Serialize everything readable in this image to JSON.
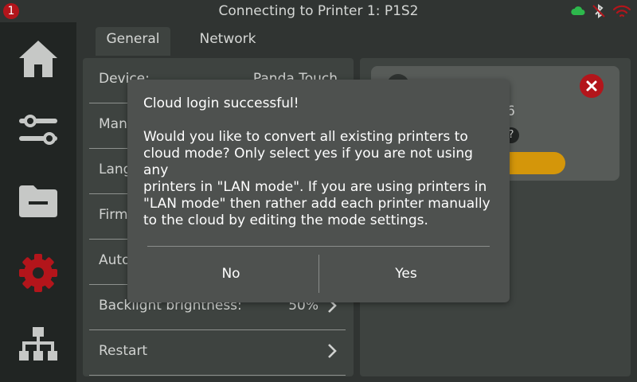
{
  "topbar": {
    "badge_count": "1",
    "title": "Connecting to Printer 1: P1S2",
    "icons": [
      "cloud-icon",
      "bluetooth-disabled-icon",
      "wifi-icon"
    ],
    "cloud_color": "#2db84c",
    "wifi_color": "#b3151b"
  },
  "sidebar": {
    "items": [
      {
        "icon": "home-icon",
        "active": false
      },
      {
        "icon": "sliders-icon",
        "active": false
      },
      {
        "icon": "folder-icon",
        "active": false
      },
      {
        "icon": "gear-icon",
        "active": true
      },
      {
        "icon": "network-icon",
        "active": false
      }
    ],
    "active_color": "#b3151b"
  },
  "tabs": [
    {
      "label": "General",
      "active": true
    },
    {
      "label": "Network",
      "active": false
    }
  ],
  "settings": {
    "rows": [
      {
        "label": "Device:",
        "value": "Panda Touch"
      },
      {
        "label": "Man",
        "value": ""
      },
      {
        "label": "Lang",
        "value": ""
      },
      {
        "label": "Firm",
        "value": ""
      },
      {
        "label": "Auto",
        "value": ""
      },
      {
        "label": "Backlight brightness:",
        "value": "50%"
      },
      {
        "label": "Restart",
        "value": ""
      }
    ]
  },
  "printer_card": {
    "visible_fragment": "6",
    "help_glyph": "?",
    "progress_color": "#d4960a",
    "close_color": "#b3151b"
  },
  "dialog": {
    "title": "Cloud login successful!",
    "message": "Would you like to convert all existing printers to\ncloud mode? Only select yes if you are not using any\nprinters in \"LAN mode\". If you are using printers in\n\"LAN mode\" then rather add each printer manually\nto the cloud by editing the mode settings.",
    "no_label": "No",
    "yes_label": "Yes"
  }
}
